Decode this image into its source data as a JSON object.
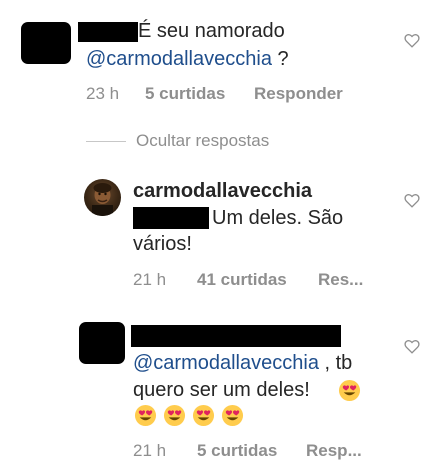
{
  "comment_1": {
    "text": "É seu namorado",
    "mention": "@carmodallavecchia",
    "text_after_mention": " ?",
    "time": "23 h",
    "likes": "5 curtidas",
    "reply": "Responder"
  },
  "replies_toggle": {
    "label": "Ocultar respostas"
  },
  "reply_1": {
    "username": "carmodallavecchia",
    "text_line1": "Um deles. São",
    "text_line2": "vários!",
    "time": "21 h",
    "likes": "41 curtidas",
    "reply": "Res..."
  },
  "reply_2": {
    "mention": "@carmodallavecchia",
    "text_line1_after": " , tb",
    "text_line2": "quero ser um deles!",
    "time": "21 h",
    "likes": "5 curtidas",
    "reply": "Resp..."
  },
  "icons": {
    "like": "heart-outline-icon",
    "emoji": "heart-eyes-emoji"
  },
  "colors": {
    "text": "#262626",
    "mention": "#1f4e8c",
    "meta": "#8e8e8e",
    "redaction": "#000000"
  }
}
